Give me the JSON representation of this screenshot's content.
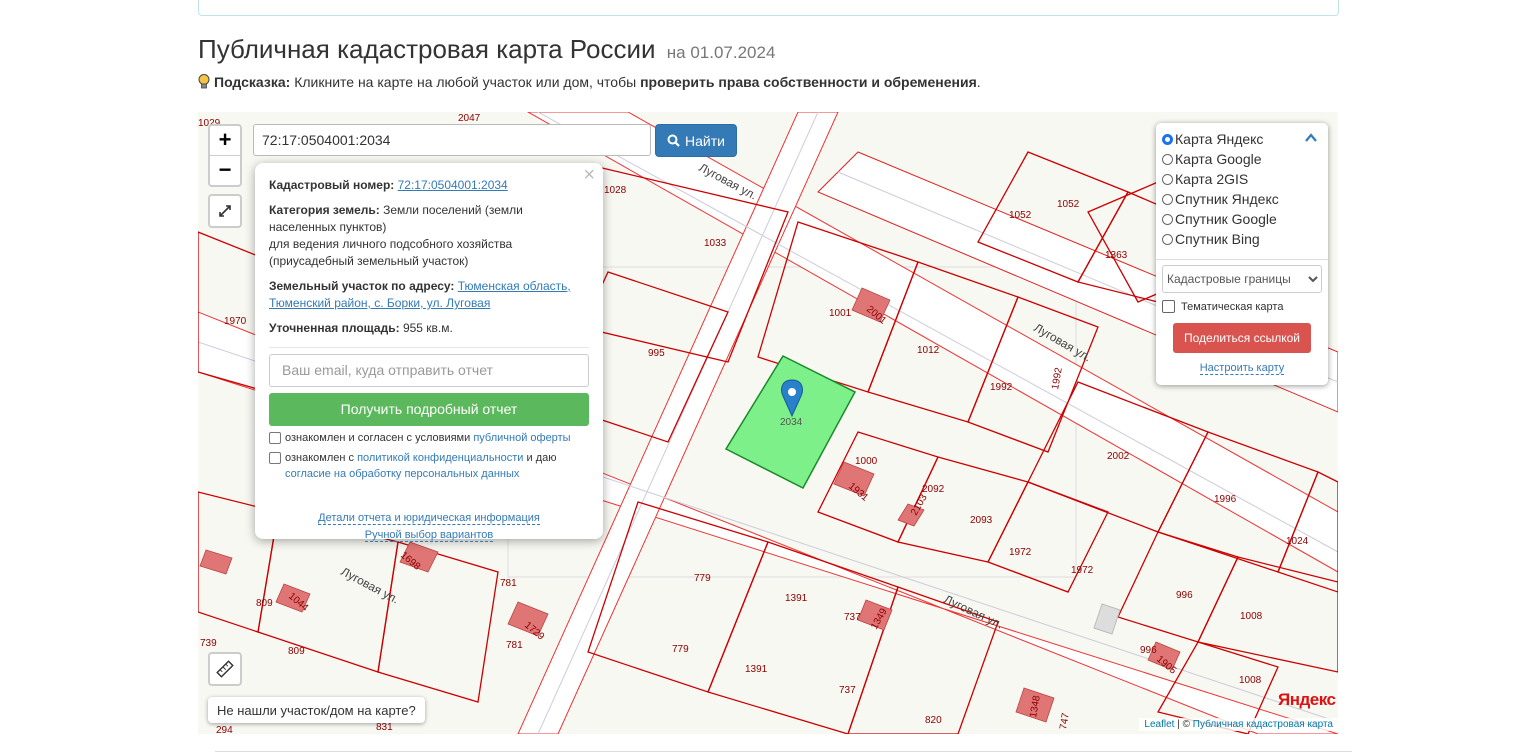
{
  "page": {
    "title": "Публичная кадастровая карта России",
    "date": "на 01.07.2024"
  },
  "hint": {
    "label": "Подсказка:",
    "text": "Кликните на карте на любой участок или дом, чтобы",
    "strong": "проверить права собственности и обременения",
    "end": "."
  },
  "search": {
    "value": "72:17:0504001:2034",
    "button_label": "Найти"
  },
  "zoom": {
    "in": "+",
    "out": "−"
  },
  "popup": {
    "cadastral_label": "Кадастровый номер:",
    "cadastral_value": "72:17:0504001:2034",
    "category_label": "Категория земель:",
    "category_value": "Земли поселений (земли населенных пунктов)",
    "use_value": "для ведения личного подсобного хозяйства (приусадебный земельный участок)",
    "address_label": "Земельный участок по адресу:",
    "address_value": "Тюменская область, Тюменский район, с. Борки, ул. Луговая",
    "area_label": "Уточненная площадь:",
    "area_value": "955 кв.м.",
    "email_placeholder": "Ваш email, куда отправить отчет",
    "report_button": "Получить подробный отчет",
    "agree1_text": "ознакомлен и согласен с условиями",
    "agree1_link": "публичной оферты",
    "agree2_text": "ознакомлен с",
    "agree2_link": "политикой конфиденциальности",
    "agree2_mid": "и даю",
    "agree2_link2": "согласие на обработку персональных данных",
    "details_link": "Детали отчета и юридическая информация",
    "manual_link": "Ручной выбор вариантов"
  },
  "layers": {
    "options": [
      "Карта Яндекс",
      "Карта Google",
      "Карта 2GIS",
      "Спутник Яндекс",
      "Спутник Google",
      "Спутник Bing"
    ],
    "selected": "Карта Яндекс",
    "overlay_select": "Кадастровые границы",
    "thematic_label": "Тематическая карта",
    "share_button": "Поделиться ссылкой",
    "setup_link": "Настроить карту"
  },
  "map": {
    "selected_parcel": "2034",
    "streets": [
      "Луговая ул.",
      "Луговая ул.",
      "Луговая ул.",
      "Луговая ул."
    ],
    "parcel_labels": [
      "1029",
      "2047",
      "1028",
      "1033",
      "1970",
      "995",
      "1001",
      "2001",
      "1012",
      "1992",
      "1992",
      "1052",
      "1052",
      "1363",
      "1000",
      "1931",
      "2092",
      "2103",
      "2093",
      "1972",
      "1972",
      "2002",
      "1996",
      "1024",
      "779",
      "779",
      "781",
      "781",
      "1391",
      "1391",
      "737",
      "737",
      "1349",
      "820",
      "809",
      "809",
      "1044",
      "1698",
      "1729",
      "739",
      "294",
      "831",
      "996",
      "996",
      "1905",
      "1008",
      "1008",
      "1348",
      "747"
    ]
  },
  "not_found_button": "Не нашли участок/дом на карте?",
  "logo": "Яндекс",
  "attribution": {
    "leaflet": "Leaflet",
    "sep": " | © ",
    "source": "Публичная кадастровая карта"
  }
}
